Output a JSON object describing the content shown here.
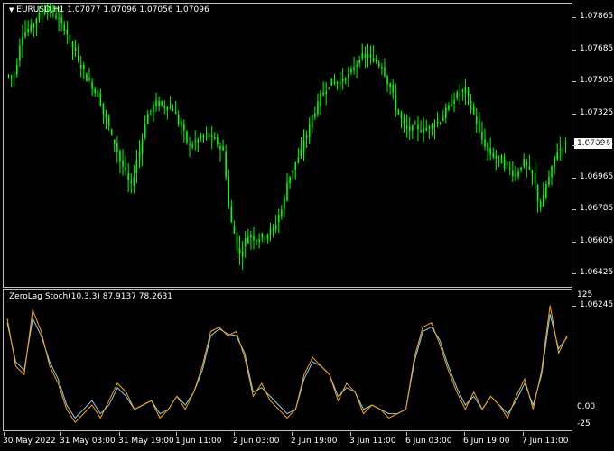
{
  "symbol_header": "EURUSD,H1  1.07077 1.07096 1.07056 1.07096",
  "indicator_header": "ZeroLag Stoch(10,3,3) 87.9137 78.2631",
  "current_price_label": "1.07096",
  "price_axis": [
    "1.07865",
    "1.07685",
    "1.07505",
    "1.07325",
    "1.07145",
    "1.06965",
    "1.06785",
    "1.06605",
    "1.06425",
    "1.06245"
  ],
  "osc_axis": [
    "125",
    "0.00",
    "-25"
  ],
  "time_axis": [
    "30 May 2022",
    "31 May 03:00",
    "31 May 19:00",
    "1 Jun 11:00",
    "2 Jun 03:00",
    "2 Jun 19:00",
    "3 Jun 11:00",
    "6 Jun 03:00",
    "6 Jun 19:00",
    "7 Jun 11:00"
  ],
  "colors": {
    "candle": "#00ff00",
    "stoch_main": "#ffa500",
    "stoch_signal": "#87cefa",
    "frame": "#c0c0c0"
  },
  "chart_data": {
    "type": "line",
    "price_series_close": [
      1.0752,
      1.0778,
      1.0782,
      1.079,
      1.0795,
      1.0789,
      1.0782,
      1.077,
      1.0758,
      1.0748,
      1.074,
      1.0725,
      1.071,
      1.0695,
      1.0683,
      1.0705,
      1.0728,
      1.0735,
      1.0733,
      1.0731,
      1.072,
      1.0708,
      1.0712,
      1.0715,
      1.0712,
      1.0705,
      1.066,
      1.064,
      1.0652,
      1.065,
      1.0652,
      1.0656,
      1.0668,
      1.069,
      1.07,
      1.0715,
      1.073,
      1.0742,
      1.0748,
      1.0748,
      1.0752,
      1.076,
      1.0765,
      1.0762,
      1.0758,
      1.0745,
      1.0728,
      1.0718,
      1.072,
      1.0718,
      1.0721,
      1.0724,
      1.0732,
      1.074,
      1.0743,
      1.0728,
      1.0712,
      1.0703,
      1.07,
      1.0695,
      1.069,
      1.0698,
      1.069,
      1.067,
      1.0688,
      1.0705,
      1.0709
    ],
    "stoch_main": [
      100,
      45,
      35,
      110,
      85,
      45,
      25,
      -5,
      -20,
      -10,
      0,
      -15,
      5,
      25,
      15,
      -5,
      0,
      5,
      -15,
      -5,
      10,
      -5,
      15,
      45,
      85,
      90,
      80,
      85,
      55,
      10,
      25,
      5,
      -5,
      -15,
      -5,
      35,
      55,
      45,
      35,
      5,
      25,
      15,
      -10,
      0,
      -5,
      -15,
      -10,
      -5,
      55,
      90,
      95,
      70,
      40,
      15,
      -5,
      15,
      -5,
      10,
      0,
      -15,
      10,
      30,
      -5,
      40,
      115,
      60,
      80
    ],
    "stoch_signal": [
      95,
      50,
      40,
      100,
      80,
      50,
      30,
      0,
      -15,
      -5,
      5,
      -10,
      0,
      20,
      10,
      -5,
      0,
      5,
      -10,
      -5,
      10,
      0,
      15,
      40,
      80,
      88,
      82,
      80,
      60,
      15,
      20,
      10,
      0,
      -10,
      -5,
      30,
      50,
      45,
      35,
      10,
      20,
      15,
      -5,
      0,
      -5,
      -10,
      -10,
      -5,
      50,
      85,
      90,
      75,
      45,
      20,
      0,
      10,
      -5,
      10,
      0,
      -10,
      5,
      25,
      0,
      35,
      105,
      65,
      78
    ]
  }
}
